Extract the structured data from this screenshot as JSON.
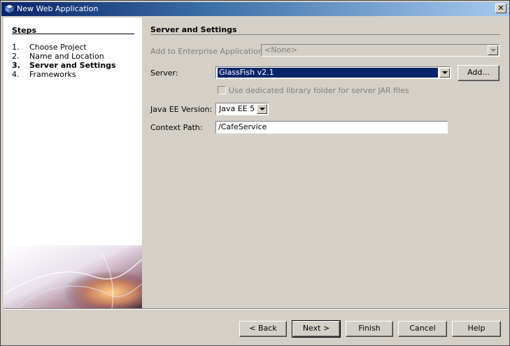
{
  "window": {
    "title": "New Web Application",
    "close_symbol": "✕"
  },
  "steps": {
    "title": "Steps",
    "items": [
      {
        "num": "1.",
        "label": "Choose Project"
      },
      {
        "num": "2.",
        "label": "Name and Location"
      },
      {
        "num": "3.",
        "label": "Server and Settings"
      },
      {
        "num": "4.",
        "label": "Frameworks"
      }
    ]
  },
  "panel": {
    "title": "Server and Settings",
    "enterprise_label": "Add to Enterprise Application:",
    "enterprise_value": "<None>",
    "server_label": "Server:",
    "server_value": "GlassFish v2.1",
    "add_button": "Add...",
    "dedicated_folder_label": "Use dedicated library folder for server JAR files",
    "javaee_label": "Java EE Version:",
    "javaee_value": "Java EE 5",
    "context_path_label": "Context Path:",
    "context_path_value": "/CafeService"
  },
  "buttons": {
    "back": "< Back",
    "next": "Next >",
    "finish": "Finish",
    "cancel": "Cancel",
    "help": "Help"
  }
}
